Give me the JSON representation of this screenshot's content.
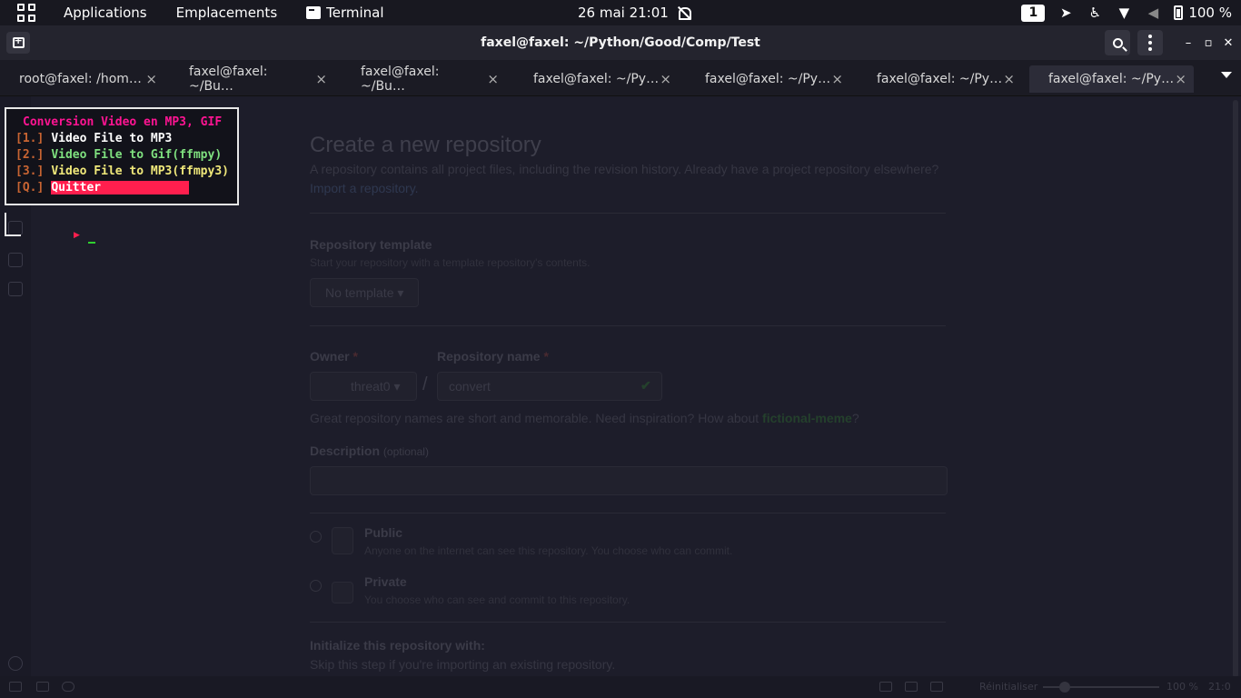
{
  "topbar": {
    "applications": "Applications",
    "places": "Emplacements",
    "active_app": "Terminal",
    "clock": "26 mai  21:01",
    "workspace": "1",
    "battery": "100 %",
    "icons": [
      "grid-icon",
      "terminal-icon",
      "notifications-off-icon",
      "telegram-icon",
      "accessibility-icon",
      "wifi-icon",
      "volume-icon",
      "battery-icon"
    ]
  },
  "window": {
    "title": "faxel@faxel: ~/Python/Good/Comp/Test",
    "minimize": "–",
    "maximize": "▫",
    "close": "✕"
  },
  "tabs": [
    {
      "label": "root@faxel: /hom…",
      "close": "×"
    },
    {
      "label": "faxel@faxel: ~/Bu…",
      "close": "×"
    },
    {
      "label": "faxel@faxel: ~/Bu…",
      "close": "×"
    },
    {
      "label": "faxel@faxel: ~/Py…",
      "close": "×"
    },
    {
      "label": "faxel@faxel: ~/Py…",
      "close": "×"
    },
    {
      "label": "faxel@faxel: ~/Py…",
      "close": "×"
    },
    {
      "label": "faxel@faxel: ~/Py…",
      "close": "×",
      "active": true
    }
  ],
  "menu": {
    "title": "Conversion Video en MP3, GIF",
    "items": [
      {
        "key": "[1.]",
        "label": "Video File to MP3"
      },
      {
        "key": "[2.]",
        "label": "Video File to Gif(ffmpy)"
      },
      {
        "key": "[3.]",
        "label": "Video File to MP3(ffmpy3)"
      },
      {
        "key": "[Q.]",
        "label": "Quitter",
        "selected": true
      }
    ],
    "prompt_marker": "▶",
    "colors": {
      "title": "#ff1493",
      "key": "#c86432",
      "selected_bg": "#ff1f4e",
      "item2": "#7fe07f",
      "item3": "#f0e87a"
    }
  },
  "ghost_page": {
    "heading": "Create a new repository",
    "subtitle": "A repository contains all project files, including the revision history. Already have a project repository elsewhere?",
    "import_link": "Import a repository.",
    "template_label": "Repository template",
    "template_hint": "Start your repository with a template repository's contents.",
    "template_value": "No template ▾",
    "owner_label": "Owner",
    "owner_required": "*",
    "owner_value": "threat0 ▾",
    "slash": "/",
    "repo_label": "Repository name",
    "repo_required": "*",
    "repo_value": "convert",
    "repo_check": "✔",
    "name_hint": "Great repository names are short and memorable. Need inspiration? How about",
    "name_suggestion": "fictional-meme",
    "name_suffix": "?",
    "desc_label": "Description",
    "desc_optional": "(optional)",
    "public_label": "Public",
    "public_hint": "Anyone on the internet can see this repository. You choose who can commit.",
    "private_label": "Private",
    "private_hint": "You choose who can see and commit to this repository.",
    "init_label": "Initialize this repository with:",
    "init_hint": "Skip this step if you're importing an existing repository.",
    "reset_label": "Réinitialiser",
    "zoom": "100 %",
    "time": "21:0"
  }
}
